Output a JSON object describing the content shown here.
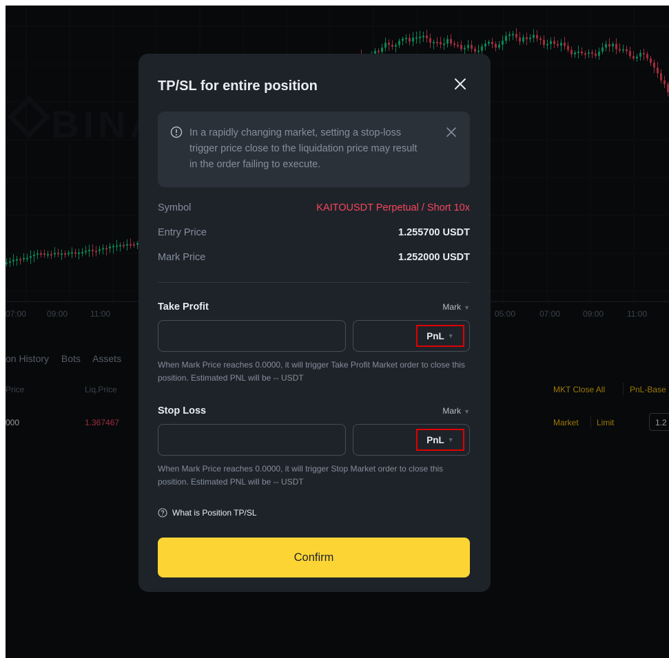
{
  "background": {
    "watermark": "BINA",
    "time_axis_left": [
      "07:00",
      "09:00",
      "11:00"
    ],
    "time_axis_right": [
      "05:00",
      "07:00",
      "09:00",
      "11:00"
    ],
    "bottom_tabs": [
      "on History",
      "Bots",
      "Assets"
    ],
    "column_price": "Price",
    "column_liq_price": "Liq.Price",
    "row_price": "000",
    "row_liq_price": "1.367467",
    "mkt_close_all": "MKT Close All",
    "pnl_based": "PnL-Base",
    "market": "Market",
    "limit": "Limit",
    "field_value": "1.2",
    "colors": {
      "up": "#0ecb81",
      "down": "#f6465d",
      "accent": "#f0b90b"
    }
  },
  "modal": {
    "title": "TP/SL for entire position",
    "notice": "In a rapidly changing market, setting a stop-loss trigger price close to the liquidation price may result in the order failing to execute.",
    "symbol_label": "Symbol",
    "symbol_value": "KAITOUSDT Perpetual / Short 10x",
    "entry_label": "Entry Price",
    "entry_value": "1.255700 USDT",
    "mark_label": "Mark Price",
    "mark_value": "1.252000 USDT",
    "take_profit": {
      "title": "Take Profit",
      "trigger_type": "Mark",
      "price_value": "",
      "unit": "PnL",
      "hint": "When Mark Price reaches 0.0000, it will trigger Take Profit Market order to close this position. Estimated PNL will be -- USDT"
    },
    "stop_loss": {
      "title": "Stop Loss",
      "trigger_type": "Mark",
      "price_value": "",
      "unit": "PnL",
      "hint": "When Mark Price reaches 0.0000, it will trigger Stop Market order to close this position. Estimated PNL will be -- USDT"
    },
    "help_link": "What is Position TP/SL",
    "confirm": "Confirm",
    "colors": {
      "confirm_bg": "#fcd535",
      "symbol": "#f6465d",
      "highlight": "#e00000"
    }
  }
}
